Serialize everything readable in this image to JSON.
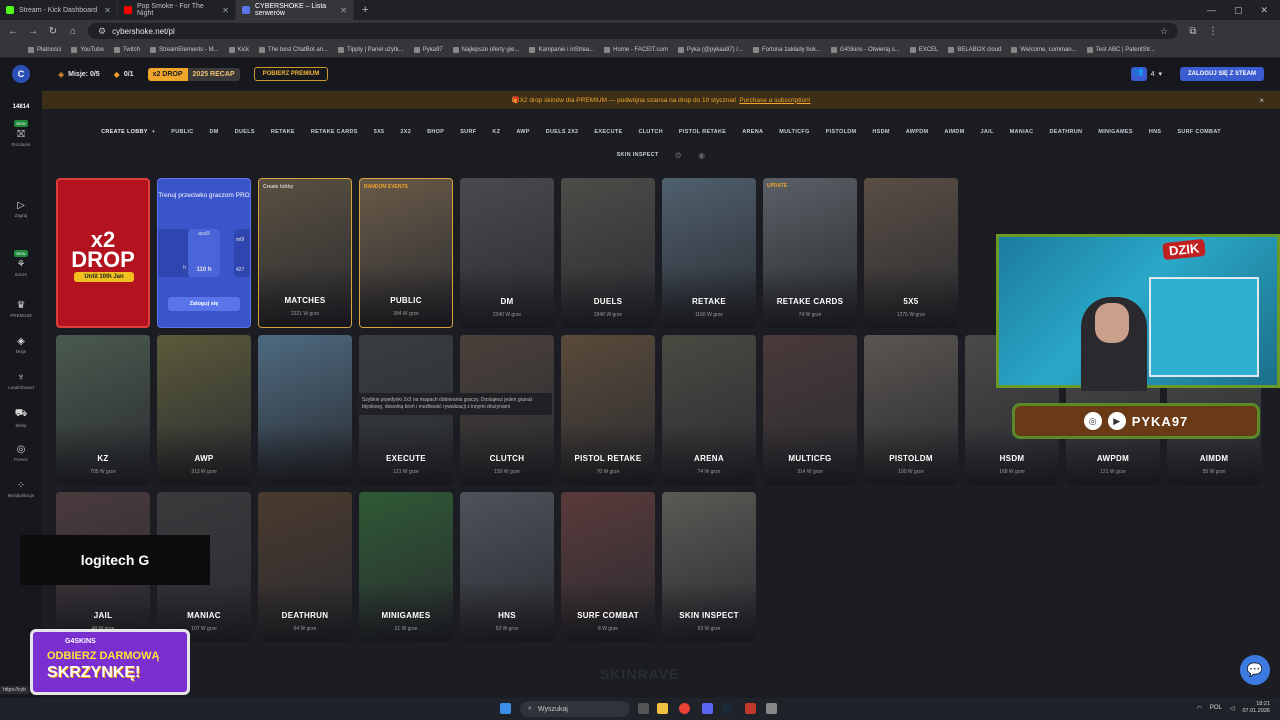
{
  "browser": {
    "tabs": [
      {
        "label": "Stream - Kick Dashboard",
        "color": "#53fc18",
        "active": false
      },
      {
        "label": "Pop Smoke - For The Night",
        "color": "#ff0000",
        "active": false
      },
      {
        "label": "CYBERSHOKE – Lista serwerów",
        "color": "#5a74e9",
        "active": true
      }
    ],
    "new_tab": "+",
    "url": "cybershoke.net/pl",
    "bookmarks": [
      "Płatności",
      "YouTube",
      "Twitch",
      "StreamElements - M...",
      "Kick",
      "The best ChatBot an...",
      "Tipply | Panel użytk...",
      "Pyka97",
      "Najlepsze oferty gie...",
      "Kampanie i inStrea...",
      "Home - FACEIT.com",
      "Pyka (@pykaa97) /...",
      "Fortuna zakłady buk...",
      "G4Skins - Otwieraj s...",
      "EXCEL",
      "BELABOX cloud",
      "Welcome, comman...",
      "Test ABC | PatentStr..."
    ]
  },
  "topnav": {
    "missions": "Misje: 0/5",
    "counter": "0/1",
    "drop_label": "x2 DROP",
    "recap_label": "2025 RECAP",
    "premium_button": "POBIERZ PREMIUM",
    "people_count": "4",
    "steam_login": "ZALOGUJ SIĘ Z STEAM"
  },
  "banner": {
    "text": "X2 drop skinów dla PREMIUM — podwójna szansa na drop do 10 stycznia!",
    "link": "Purchase a subscription!",
    "close": "×"
  },
  "sidebar": {
    "count": "14814",
    "items": [
      {
        "label": "Rozdanie",
        "new": "NEW",
        "icon": "gift-icon",
        "glyph": "⛝"
      },
      {
        "label": "Zagraj",
        "new": "",
        "icon": "play-icon",
        "glyph": "▷"
      },
      {
        "label": "Itecze",
        "new": "NEW",
        "icon": "tree-icon",
        "glyph": "⚘"
      },
      {
        "label": "PREMIUM",
        "new": "",
        "icon": "crown-icon",
        "glyph": "♛"
      },
      {
        "label": "Misje",
        "new": "",
        "icon": "target-icon",
        "glyph": "◈"
      },
      {
        "label": "Leaderboard",
        "new": "",
        "icon": "trophy-icon",
        "glyph": "♆"
      },
      {
        "label": "Sklep",
        "new": "",
        "icon": "cart-icon",
        "glyph": "⛟"
      },
      {
        "label": "Pomoc",
        "new": "",
        "icon": "help-icon",
        "glyph": "◎"
      },
      {
        "label": "Minialplikacje",
        "new": "",
        "icon": "apps-icon",
        "glyph": "⁘"
      }
    ]
  },
  "modes_row1": [
    "CREATE LOBBY",
    "PUBLIC",
    "DM",
    "DUELS",
    "RETAKE",
    "RETAKE CARDS",
    "5X5",
    "2X2",
    "BHOP",
    "SURF",
    "KZ",
    "AWP",
    "DUELS 2X2",
    "EXECUTE",
    "CLUTCH",
    "PISTOL RETAKE",
    "ARENA",
    "MULTICFG",
    "PISTOLDM",
    "HSDM",
    "AWPDM",
    "AIMDM",
    "JAIL",
    "MANIAC",
    "DEATHRUN",
    "MINIGAMES",
    "HNS",
    "SURF COMBAT"
  ],
  "modes_row2": [
    "SKIN INSPECT"
  ],
  "promo_drop": {
    "big1": "x2",
    "big2": "DROP",
    "pill": "Until 10th Jan"
  },
  "promo_pro": {
    "title": "Trenuj przeciwko graczom PRO",
    "player": "acoR",
    "stat": "110 h",
    "left_stat": "h",
    "right_stat": "427",
    "right_name": "m0l",
    "login": "Zaloguj się"
  },
  "cards": [
    {
      "title": "MATCHES",
      "sub": "2321 W grze",
      "tag": "Create lobby",
      "tagColor": "#cccccc",
      "gold": true,
      "bg": "#5a5040"
    },
    {
      "title": "PUBLIC",
      "sub": "384 W grze",
      "tag": "RANDOM EVENTS",
      "tagColor": "#f0a52b",
      "gold": true,
      "bg": "#6a5a48"
    },
    {
      "title": "DM",
      "sub": "2340 W grze",
      "tag": "",
      "gold": false,
      "bg": "#4a4a4e"
    },
    {
      "title": "DUELS",
      "sub": "2948 W grze",
      "tag": "",
      "gold": false,
      "bg": "#4e4c48"
    },
    {
      "title": "RETAKE",
      "sub": "1166 W grze",
      "tag": "",
      "gold": false,
      "bg": "#50606e"
    },
    {
      "title": "RETAKE CARDS",
      "sub": "74 W grze",
      "tag": "UPDATE",
      "tagColor": "#f0a52b",
      "gold": false,
      "bg": "#5a6066"
    },
    {
      "title": "5X5",
      "sub": "1275 W grze",
      "tag": "",
      "gold": false,
      "bg": "#5a4e44"
    },
    {
      "title": "KZ",
      "sub": "705 W grze",
      "tag": "",
      "gold": false,
      "bg": "#4a5a4e"
    },
    {
      "title": "AWP",
      "sub": "313 W grze",
      "tag": "",
      "gold": false,
      "bg": "#5a5a3a"
    },
    {
      "title": "",
      "sub": "",
      "tag": "",
      "gold": false,
      "bg": "#4e6a80"
    },
    {
      "title": "EXECUTE",
      "sub": "121 W grze",
      "tag": "",
      "gold": false,
      "bg": "#3a3e40"
    },
    {
      "title": "CLUTCH",
      "sub": "150 W grze",
      "tag": "",
      "gold": false,
      "bg": "#4a403a"
    },
    {
      "title": "PISTOL RETAKE",
      "sub": "70 W grze",
      "tag": "",
      "gold": false,
      "bg": "#5a4a3a"
    },
    {
      "title": "ARENA",
      "sub": "74 W grze",
      "tag": "",
      "gold": false,
      "bg": "#4a4a42"
    },
    {
      "title": "MULTICFG",
      "sub": "314 W grze",
      "tag": "",
      "gold": false,
      "bg": "#4a3a3a"
    },
    {
      "title": "PISTOLDM",
      "sub": "190 W grze",
      "tag": "",
      "gold": false,
      "bg": "#5a5550"
    },
    {
      "title": "HSDM",
      "sub": "168 W grze",
      "tag": "",
      "gold": false,
      "bg": "#4a4a48"
    },
    {
      "title": "AWPDM",
      "sub": "121 W grze",
      "tag": "",
      "gold": false,
      "bg": "#4a4a48"
    },
    {
      "title": "AIMDM",
      "sub": "55 W grze",
      "tag": "",
      "gold": false,
      "bg": "#4a4a48"
    },
    {
      "title": "JAIL",
      "sub": "48 W grze",
      "tag": "",
      "gold": false,
      "bg": "#4a3a3e"
    },
    {
      "title": "MANIAC",
      "sub": "107 W grze",
      "tag": "",
      "gold": false,
      "bg": "#3a3a3c"
    },
    {
      "title": "DEATHRUN",
      "sub": "64 W grze",
      "tag": "",
      "gold": false,
      "bg": "#4a3a2e"
    },
    {
      "title": "MINIGAMES",
      "sub": "21 W grze",
      "tag": "",
      "gold": false,
      "bg": "#2e5a34"
    },
    {
      "title": "HNS",
      "sub": "53 W grze",
      "tag": "",
      "gold": false,
      "bg": "#4e525a"
    },
    {
      "title": "SURF COMBAT",
      "sub": "8 W grze",
      "tag": "",
      "gold": false,
      "bg": "#5a3a3a"
    },
    {
      "title": "SKIN INSPECT",
      "sub": "53 W grze",
      "tag": "",
      "gold": false,
      "bg": "#5a5a55"
    }
  ],
  "tooltip": "Szybkie pojedynki 2x2 na mapach dobierania graczy. Dostajesz jeden granat błyskowy, dowolną broń i możliwość rywalizacji z innymi drużynami",
  "overlay": {
    "webcam_badge": "DZIK",
    "handle": "PYKA97",
    "logitech": "logitech",
    "g4_brand": "G4SKINS",
    "g4_line1": "ODBIERZ DARMOWĄ",
    "g4_line2": "SKRZYNKĘ!",
    "skinrave": "SKINRAVE"
  },
  "statusbar": {
    "url": "https://cyb"
  },
  "taskbar": {
    "search": "Wyszukaj",
    "lang": "POL",
    "time": "18:21",
    "date": "07.01.2026"
  }
}
